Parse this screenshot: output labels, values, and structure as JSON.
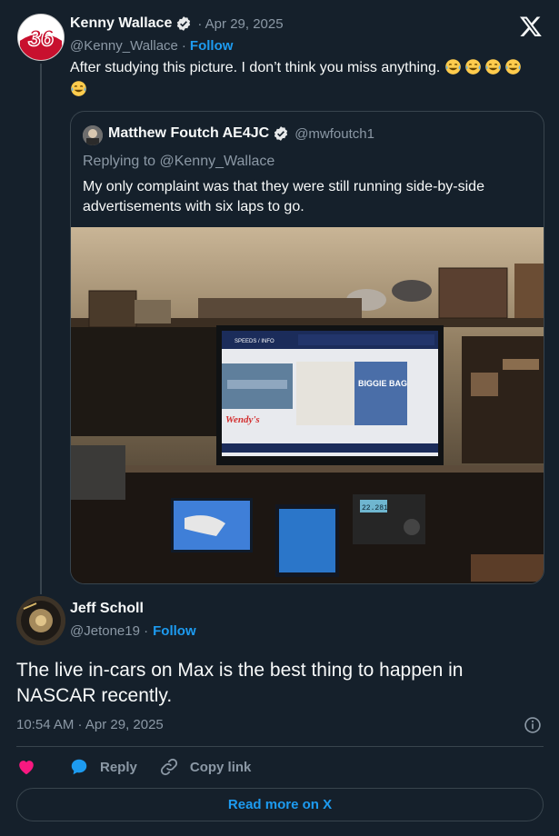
{
  "brand": {
    "accent": "#1d9bf0",
    "background": "#15202b",
    "border": "#38444d",
    "muted": "#8b98a5",
    "like": "#f91880"
  },
  "tweet": {
    "author": "Kenny Wallace",
    "date": "· Apr 29, 2025",
    "handle": "@Kenny_Wallace",
    "follow_label": "Follow",
    "text": "After studying this picture. I don’t think you miss anything.",
    "emoji": [
      "joy-emoji",
      "joy-emoji",
      "joy-emoji",
      "joy-emoji",
      "joy-emoji"
    ]
  },
  "quote": {
    "author": "Matthew Foutch AE4JC",
    "handle": "@mwfoutch1",
    "replying_to": "Replying to @Kenny_Wallace",
    "text": "My only complaint was that they were still running side-by-side advertisements with six laps to go.",
    "image": {
      "tv_ad_1": "Wendy's",
      "tv_ad_2": "BIGGIE BAG",
      "tv_header": "SPEEDS / INFO",
      "radio_readout": "22.281"
    }
  },
  "reply": {
    "author": "Jeff Scholl",
    "handle": "@Jetone19 ·",
    "follow_label": "Follow",
    "text": "The live in-cars on Max is the best thing to happen in NASCAR recently.",
    "timestamp": "10:54 AM · Apr 29, 2025"
  },
  "actions": {
    "reply_label": "Reply",
    "copy_label": "Copy link",
    "read_more_label": "Read more on X"
  },
  "icons": [
    "x-logo-icon",
    "verified-badge-icon",
    "info-icon",
    "heart-icon",
    "reply-bubble-icon",
    "link-icon"
  ]
}
